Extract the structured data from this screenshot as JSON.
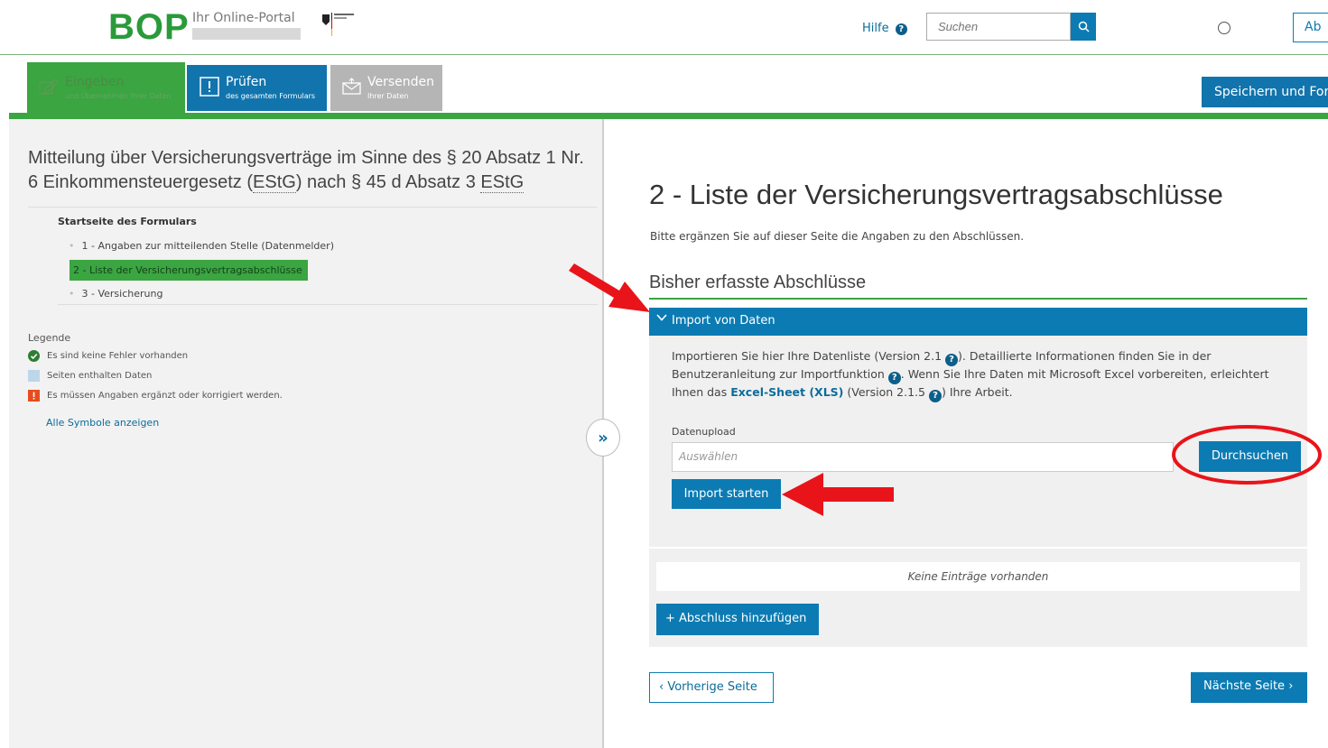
{
  "header": {
    "logo": "BOP",
    "portal_subtitle": "Ihr Online-Portal",
    "help_label": "Hilfe",
    "help_icon": "?",
    "search_placeholder": "Suchen",
    "account_button_label": "Ab"
  },
  "tabs": [
    {
      "label": "Eingeben",
      "sub": "und Übernehmen Ihrer Daten",
      "icon": "pencil-icon"
    },
    {
      "label": "Prüfen",
      "sub": "des gesamten Formulars",
      "icon": "exclamation-icon"
    },
    {
      "label": "Versenden",
      "sub": "Ihrer Daten",
      "icon": "envelope-icon"
    }
  ],
  "save_button_label": "Speichern und Fortfahren",
  "sidebar": {
    "form_title_part1": "Mitteilung über Versicherungsverträge im Sinne des § 20 Absatz 1 Nr. 6 Einkommensteuergesetz (",
    "estg_1": "EStG",
    "form_title_part2": ") nach § 45 d Absatz 3 ",
    "estg_2": "EStG",
    "start_link": "Startseite des Formulars",
    "nav_items": [
      "1 - Angaben zur mitteilenden Stelle (Datenmelder)",
      "2 - Liste der Versicherungsvertragsabschlüsse",
      "3 - Versicherung"
    ],
    "legend_heading": "Legende",
    "legend_items": [
      {
        "text": "Es sind keine Fehler vorhanden",
        "color": "#2e7d32"
      },
      {
        "text": "Seiten enthalten Daten",
        "color": "#bcd6ea"
      },
      {
        "text": "Es müssen Angaben ergänzt oder korrigiert werden.",
        "color": "#e84c1d"
      }
    ],
    "all_symbols_link": "Alle Symbole anzeigen"
  },
  "main": {
    "title": "2 - Liste der Versicherungsvertragsabschlüsse",
    "subtitle": "Bitte ergänzen Sie auf dieser Seite die Angaben zu den Abschlüssen.",
    "section_title": "Bisher erfasste Abschlüsse",
    "accordion_title": "Import von Daten",
    "import_text_1": "Importieren Sie hier Ihre Datenliste (Version 2.1 ",
    "import_text_2": "). Detaillierte Informationen finden Sie in der Benutzeranleitung zur Importfunktion ",
    "import_text_3": ". Wenn Sie Ihre Daten mit Microsoft Excel vorbereiten, erleichtert Ihnen das ",
    "excel_link": "Excel-Sheet (XLS)",
    "import_text_4": " (Version 2.1.5 ",
    "import_text_5": ") Ihre Arbeit.",
    "upload_label": "Datenupload",
    "upload_placeholder": "Auswählen",
    "browse_button": "Durchsuchen",
    "import_button": "Import starten",
    "empty_text": "Keine Einträge vorhanden",
    "add_button": "+ Abschluss hinzufügen",
    "prev_button": "Vorherige Seite",
    "next_button": "Nächste Seite"
  },
  "colors": {
    "brand_green": "#3aa541",
    "primary_blue": "#0c7bb3",
    "annotation_red": "#e8141a"
  }
}
